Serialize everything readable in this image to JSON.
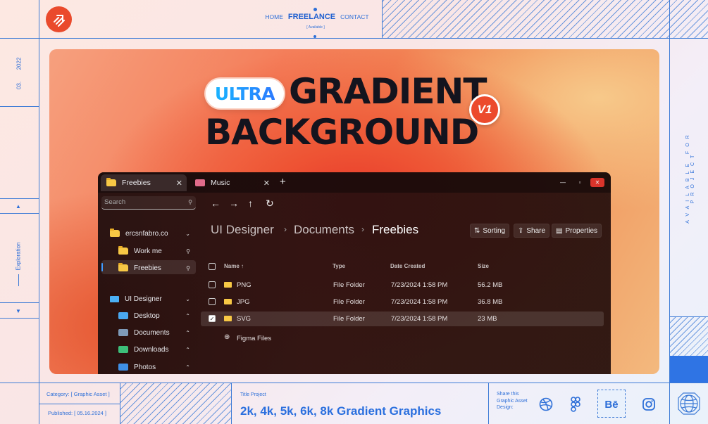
{
  "nav": {
    "home": "HOME",
    "freelance": "FREELANCE",
    "contact": "CONTACT",
    "available": "[ Available ]"
  },
  "left": {
    "year": "2022",
    "month": "03.",
    "exploration": "Exploration"
  },
  "right": {
    "available_for_project": "AVAILABLE FOR PROJECT"
  },
  "hero": {
    "ultra": "ULTRA",
    "line1": "GRADIENT",
    "line2": "BACKGROUND",
    "badge": "V1"
  },
  "explorer": {
    "tabs": [
      {
        "label": "Freebies"
      },
      {
        "label": "Music"
      }
    ],
    "search_placeholder": "Search",
    "sidebar": [
      {
        "label": "ercsnfabro.co"
      },
      {
        "label": "Work me"
      },
      {
        "label": "Freebies"
      },
      {
        "label": "UI Designer"
      },
      {
        "label": "Desktop"
      },
      {
        "label": "Documents"
      },
      {
        "label": "Downloads"
      },
      {
        "label": "Photos"
      }
    ],
    "breadcrumb": [
      "UI Designer",
      "Documents",
      "Freebies"
    ],
    "toolbar": {
      "sorting": "Sorting",
      "share": "Share",
      "properties": "Properties"
    },
    "columns": {
      "name": "Name",
      "type": "Type",
      "date": "Date Created",
      "size": "Size"
    },
    "rows": [
      {
        "name": "PNG",
        "type": "File Folder",
        "date": "7/23/2024 1:58 PM",
        "size": "56.2 MB"
      },
      {
        "name": "JPG",
        "type": "File Folder",
        "date": "7/23/2024 1:58 PM",
        "size": "36.8 MB"
      },
      {
        "name": "SVG",
        "type": "File Folder",
        "date": "7/23/2024 1:58 PM",
        "size": "23 MB"
      }
    ],
    "extra_item": "Figma Files"
  },
  "footer": {
    "category_label": "Category:",
    "category_value": "[ Graphic Asset ]",
    "published_label": "Published:",
    "published_value": "[ 05.16.2024 ]",
    "title_label": "Title Project",
    "title_value": "2k, 4k, 5k, 6k, 8k Gradient Graphics",
    "share_text": "Share this Graphic Asset Design:",
    "socials": [
      "dribbble-icon",
      "figma-icon",
      "behance-icon",
      "instagram-icon"
    ]
  },
  "colors": {
    "accent_blue": "#2d6fd8",
    "brand_orange": "#ea4a2c"
  }
}
